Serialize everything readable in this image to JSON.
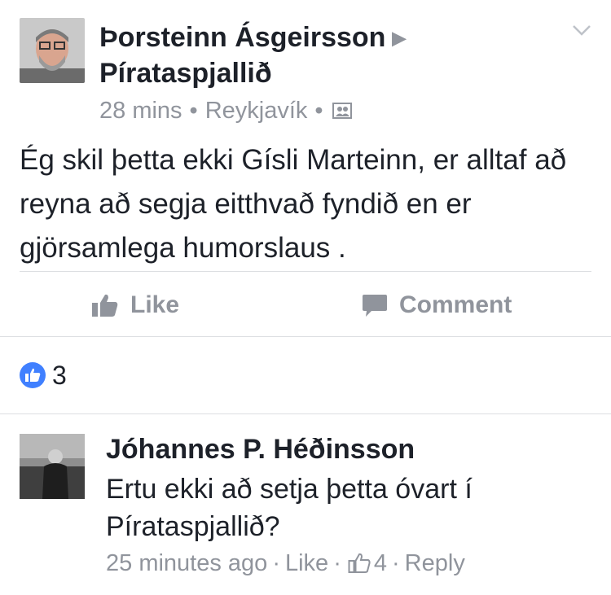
{
  "post": {
    "author": "Þorsteinn Ásgeirsson",
    "group": "Pírataspjallið",
    "time": "28 mins",
    "location": "Reykjavík",
    "audience_icon": "closed-group-icon",
    "text": "Ég skil þetta ekki Gísli Marteinn, er alltaf að reyna að segja eitthvað fyndið en er gjörsamlega humorslaus ."
  },
  "actions": {
    "like_label": "Like",
    "comment_label": "Comment"
  },
  "reactions": {
    "count": "3",
    "icon": "like-reaction-icon"
  },
  "comment": {
    "author": "Jóhannes P. Héðinsson",
    "text": "Ertu ekki að setja þetta óvart  í Pírataspjallið?",
    "time": "25 minutes ago",
    "like_label": "Like",
    "like_count": "4",
    "reply_label": "Reply"
  },
  "colors": {
    "text": "#1d2129",
    "meta": "#90949c",
    "accent": "#4080ff",
    "divider": "#dddfe2"
  }
}
